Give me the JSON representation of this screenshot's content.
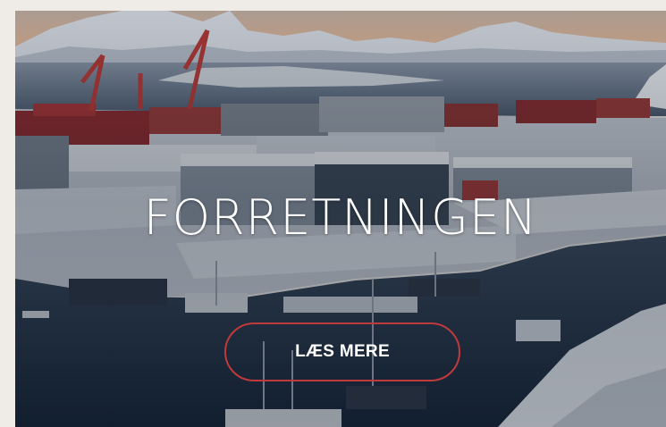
{
  "hero": {
    "title": "FORRETNINGEN",
    "image_description_name": "harbor-photo",
    "cta_label": "LÆS MERE"
  },
  "colors": {
    "page_background": "#efebe6",
    "cta_border": "#c0393b",
    "text": "#ffffff"
  }
}
